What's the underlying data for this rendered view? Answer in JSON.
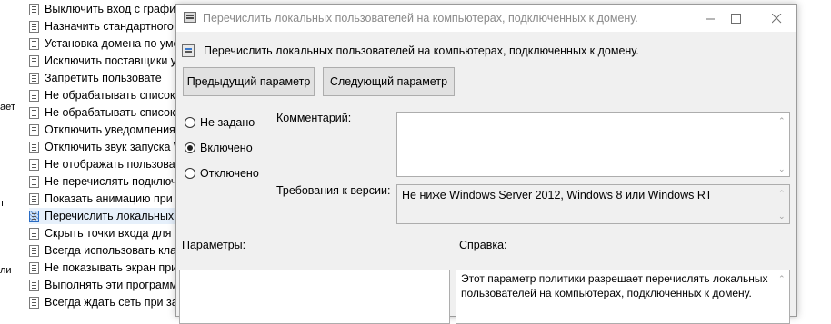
{
  "background": {
    "side_labels": [
      "ает",
      "т",
      "ли"
    ],
    "policies": [
      {
        "label": "Выключить вход с графич",
        "selected": false
      },
      {
        "label": "Назначить стандартного п",
        "selected": false
      },
      {
        "label": "Установка домена по умол",
        "selected": false
      },
      {
        "label": "Исключить поставщики у",
        "selected": false
      },
      {
        "label": "Запретить пользовате",
        "selected": false
      },
      {
        "label": "Не обрабатывать список з",
        "selected": false
      },
      {
        "label": "Не обрабатывать список с",
        "selected": false
      },
      {
        "label": "Отключить уведомления",
        "selected": false
      },
      {
        "label": "Отключить звук запуска W",
        "selected": false
      },
      {
        "label": "Не отображать пользовате",
        "selected": false
      },
      {
        "label": "Не перечислять подключ",
        "selected": false
      },
      {
        "label": "Показать анимацию при п",
        "selected": false
      },
      {
        "label": "Перечислить локальных п",
        "selected": true
      },
      {
        "label": "Скрыть точки входа для б",
        "selected": false
      },
      {
        "label": "Всегда использовать класс",
        "selected": false
      },
      {
        "label": "Не показывать экран прив",
        "selected": false
      },
      {
        "label": "Выполнять эти программ",
        "selected": false
      },
      {
        "label": "Всегда ждать сеть при запу",
        "selected": false
      }
    ]
  },
  "dialog": {
    "title": "Перечислить локальных пользователей на компьютерах, подключенных к домену.",
    "header": "Перечислить локальных пользователей на компьютерах, подключенных к домену.",
    "prev_button": "Предыдущий параметр",
    "next_button": "Следующий параметр",
    "radio_not_configured": "Не задано",
    "radio_enabled": "Включено",
    "radio_disabled": "Отключено",
    "selected_state": "Включено",
    "comment_label": "Комментарий:",
    "comment_value": "",
    "version_label": "Требования к версии:",
    "version_value": "Не ниже Windows Server 2012, Windows 8 или Windows RT",
    "options_label": "Параметры:",
    "help_label": "Справка:",
    "help_text": "Этот параметр политики разрешает перечислять локальных пользователей на компьютерах, подключенных к домену."
  },
  "icons": {
    "minimize": "minimize-icon",
    "maximize": "maximize-icon",
    "close": "close-icon",
    "scroll_up": "chevron-up-icon",
    "scroll_down": "chevron-down-icon"
  }
}
